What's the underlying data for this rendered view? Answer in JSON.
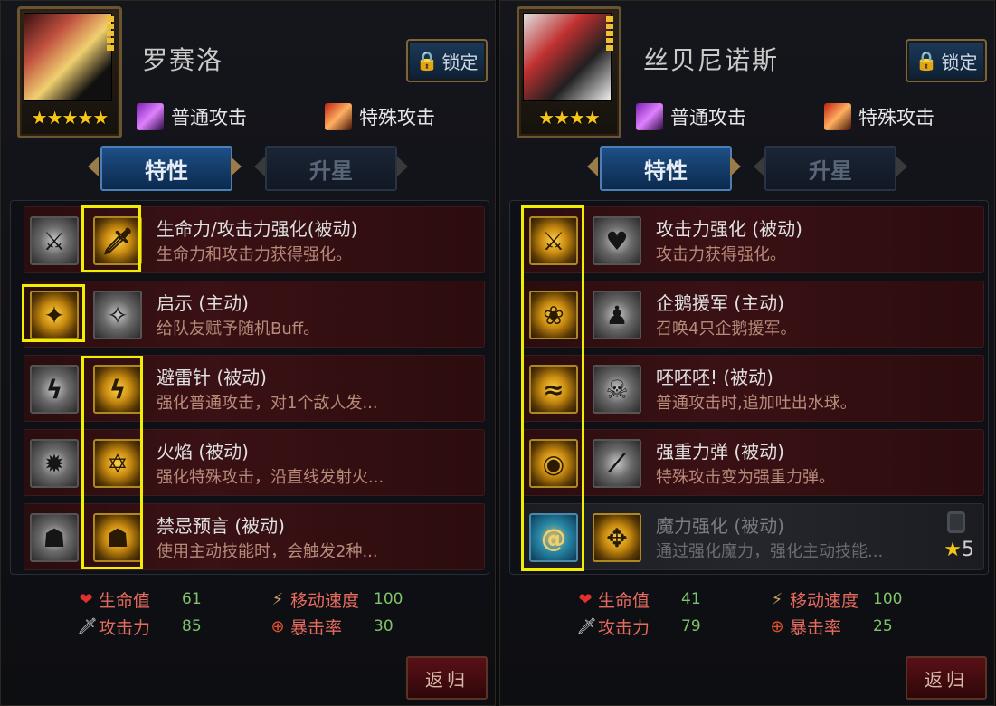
{
  "buttons": {
    "lock_label": "锁定",
    "return_label": "返归"
  },
  "attack_types": {
    "normal": "普通攻击",
    "special": "特殊攻击"
  },
  "tabs": {
    "traits": "特性",
    "star_up": "升星"
  },
  "stat_labels": {
    "hp": "生命值",
    "atk": "攻击力",
    "speed": "移动速度",
    "crit": "暴击率"
  },
  "left": {
    "name": "罗赛洛",
    "stars": "★★★★★",
    "skills": [
      {
        "title": "生命力/攻击力强化(被动)",
        "desc": "生命力和攻击力获得强化。"
      },
      {
        "title": "启示 (主动)",
        "desc": "给队友赋予随机Buff。"
      },
      {
        "title": "避雷针 (被动)",
        "desc": "强化普通攻击，对1个敌人发..."
      },
      {
        "title": "火焰 (被动)",
        "desc": "强化特殊攻击，沿直线发射火..."
      },
      {
        "title": "禁忌预言 (被动)",
        "desc": "使用主动技能时，会触发2种..."
      }
    ],
    "stats": {
      "hp": "61",
      "atk": "85",
      "speed": "100",
      "crit": "30"
    }
  },
  "right": {
    "name": "丝贝尼诺斯",
    "stars": "★★★★",
    "skills": [
      {
        "title": "攻击力强化 (被动)",
        "desc": "攻击力获得强化。"
      },
      {
        "title": "企鹅援军 (主动)",
        "desc": "召唤4只企鹅援军。"
      },
      {
        "title": "呸呸呸! (被动)",
        "desc": "普通攻击时,追加吐出水球。"
      },
      {
        "title": "强重力弹 (被动)",
        "desc": "特殊攻击变为强重力弹。"
      },
      {
        "title": "魔力强化 (被动)",
        "desc": "通过强化魔力，强化主动技能..."
      }
    ],
    "unlock_star": "5",
    "stats": {
      "hp": "41",
      "atk": "79",
      "speed": "100",
      "crit": "25"
    }
  },
  "colors": {
    "highlight": "#f2ee00",
    "tab_active": "#1d4f86",
    "star": "#f5c518"
  }
}
